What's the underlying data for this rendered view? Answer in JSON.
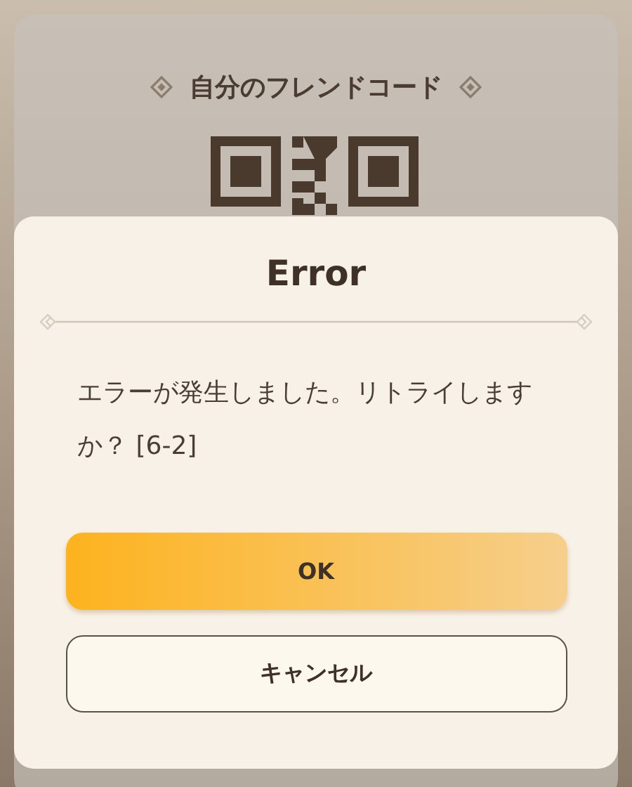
{
  "background_card": {
    "title": "自分のフレンドコード"
  },
  "dialog": {
    "title": "Error",
    "message": "エラーが発生しました。リトライしますか？ [6-2]",
    "buttons": [
      {
        "label": "OK",
        "kind": "primary"
      },
      {
        "label": "キャンセル",
        "kind": "secondary"
      }
    ]
  }
}
